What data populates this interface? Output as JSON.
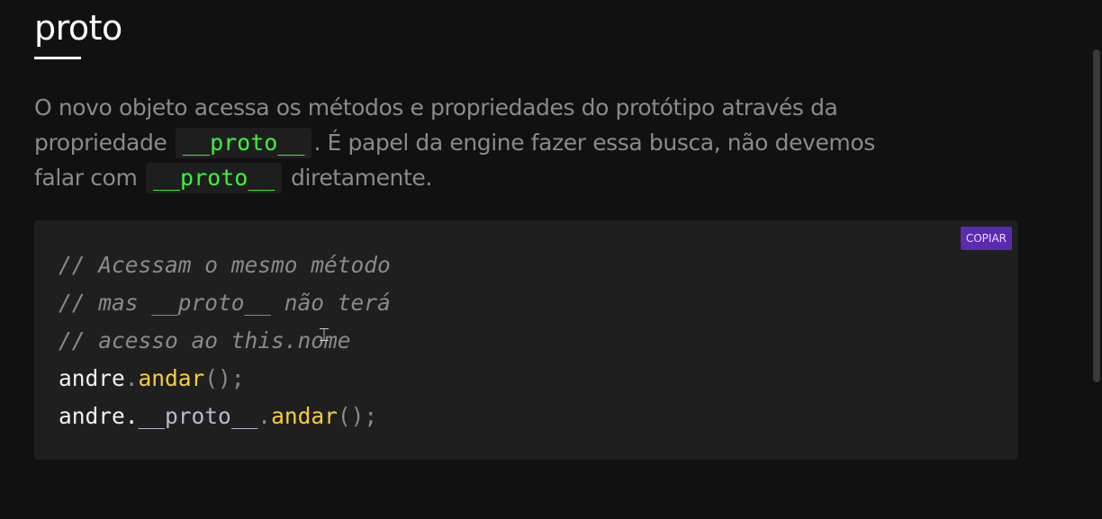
{
  "section": {
    "title": "proto"
  },
  "paragraph": {
    "part1": "O novo objeto acessa os métodos e propriedades do protótipo através da propriedade ",
    "code1": "__proto__",
    "part2": ". É papel da engine fazer essa busca, não devemos falar com ",
    "code2": "__proto__",
    "part3": " diretamente."
  },
  "code_block": {
    "copy_label": "COPIAR",
    "lines": {
      "l1": "// Acessam o mesmo método",
      "l2": "// mas __proto__ não terá",
      "l3": "// acesso ao this.nome",
      "l4_obj": "andre",
      "l4_dot": ".",
      "l4_method": "andar",
      "l4_end": "();",
      "l5_obj": "andre",
      "l5_dot1": ".",
      "l5_proto": "__proto__",
      "l5_dot2": ".",
      "l5_method": "andar",
      "l5_end": "();"
    }
  },
  "colors": {
    "background": "#111111",
    "inline_code": "#3cf23c",
    "method": "#f7cd3b",
    "copy_button": "#5b2ab0"
  }
}
